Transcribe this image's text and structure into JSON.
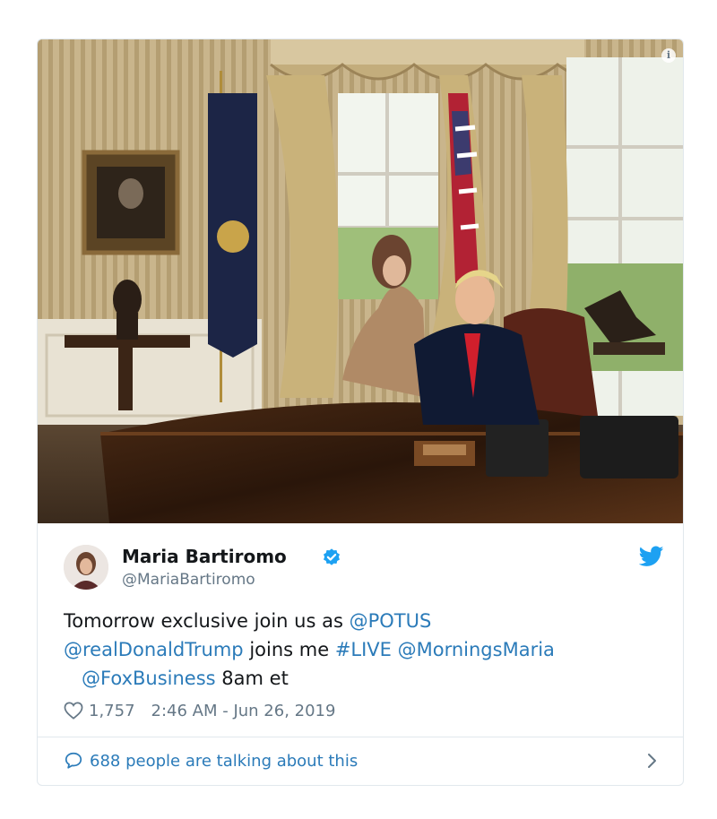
{
  "tweet": {
    "author_name": "Maria Bartiromo",
    "handle": "@MariaBartiromo",
    "text_parts": {
      "p1": "Tomorrow exclusive join us as ",
      "potus": "@POTUS",
      "trump": "@realDonaldTrump",
      "p2": " joins me ",
      "live": "#LIVE",
      "mornings": "@MorningsMaria",
      "fox": "@FoxBusiness",
      "p3": " 8am et"
    },
    "likes": "1,757",
    "timestamp": "2:46 AM - Jun 26, 2019",
    "talking": "688 people are talking about this"
  },
  "icons": {
    "info": "info-icon",
    "verified": "verified-badge-icon",
    "brand": "twitter-bird-icon",
    "like": "heart-icon",
    "reply": "speech-bubble-icon",
    "chevron": "chevron-right-icon"
  },
  "colors": {
    "link": "#2b7bb9",
    "muted": "#657786",
    "verified": "#1da1f2",
    "border": "#e1e8ed"
  }
}
